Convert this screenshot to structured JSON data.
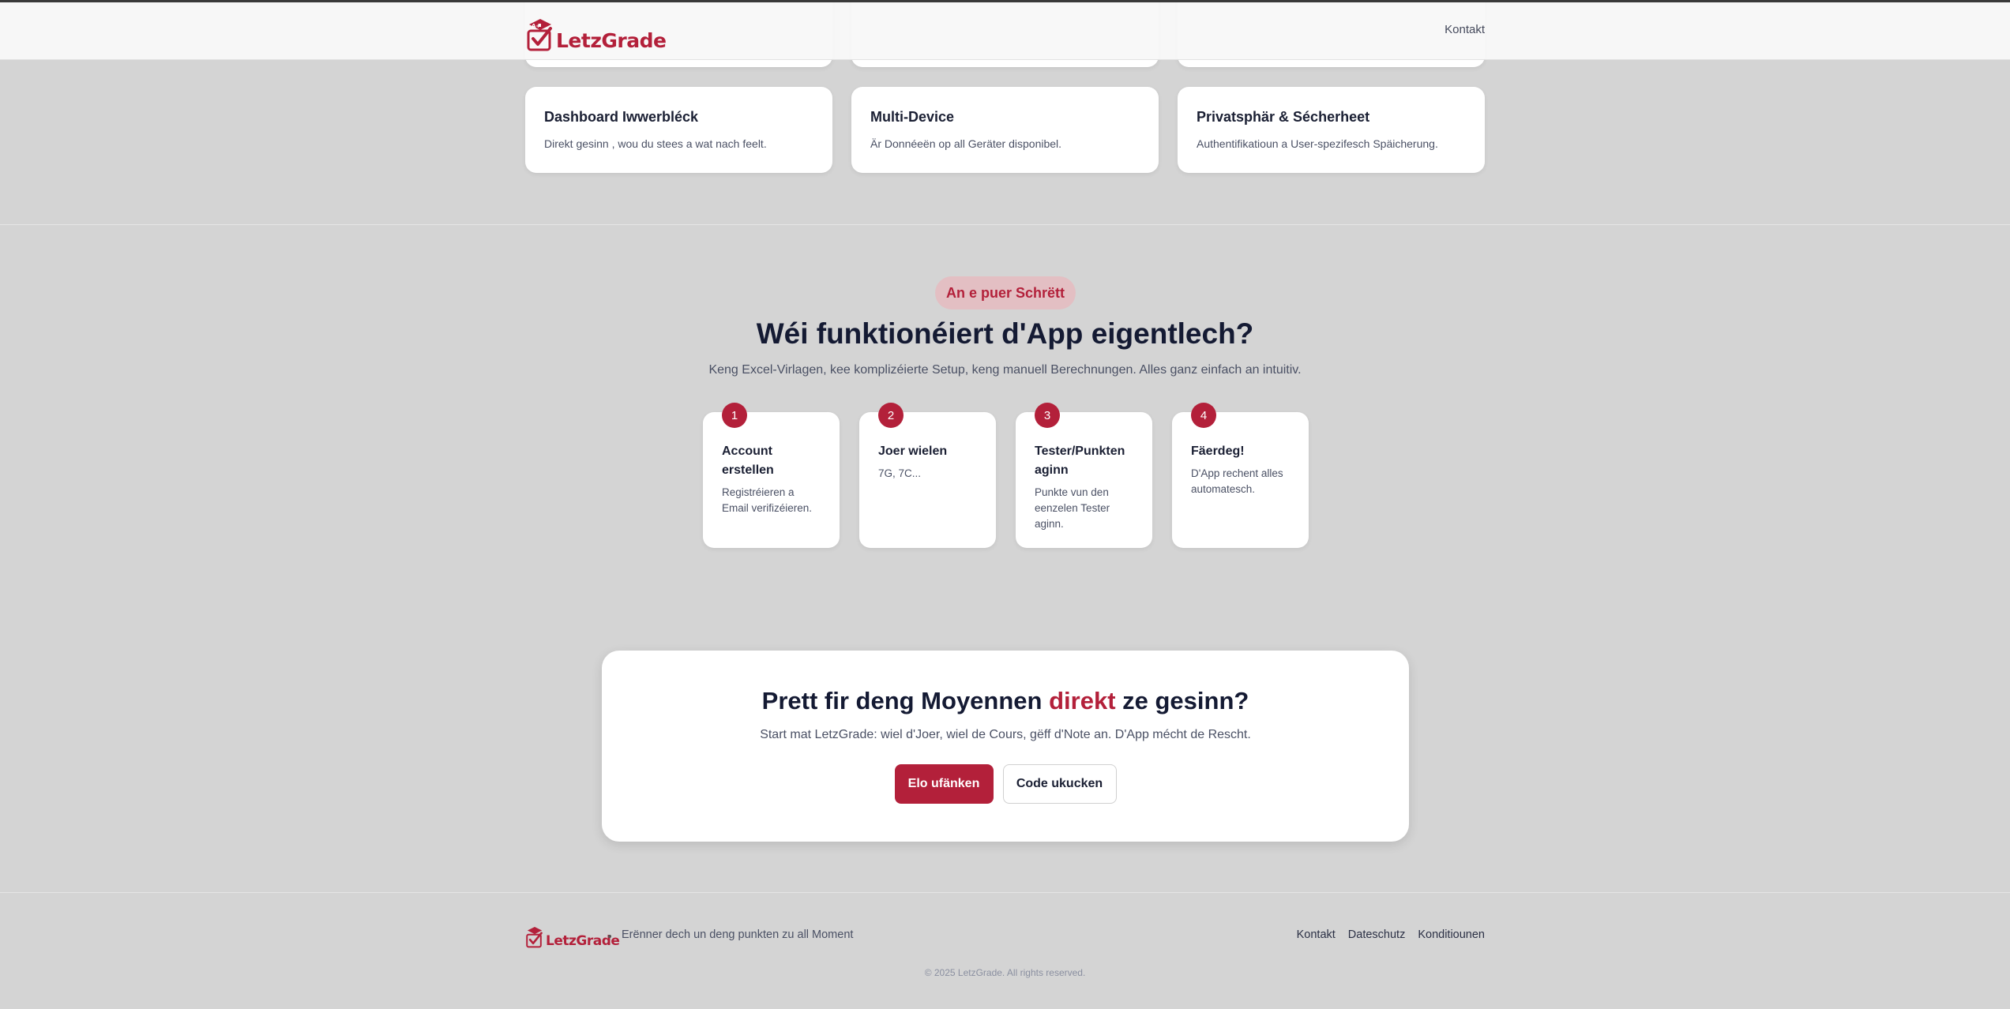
{
  "header": {
    "brand": "LetzGrade",
    "nav": {
      "contact": "Kontakt"
    }
  },
  "features": [
    {
      "title": "Dashboard Iwwerbléck",
      "description": "Direkt gesinn , wou du stees a wat nach feelt."
    },
    {
      "title": "Multi-Device",
      "description": "Är Donnéeën op all Geräter disponibel."
    },
    {
      "title": "Privatsphär & Sécherheet",
      "description": "Authentifikatioun a User-spezifesch Späicherung."
    }
  ],
  "how_it_works": {
    "badge": "An e puer Schrëtt",
    "title": "Wéi funktionéiert d'App eigentlech?",
    "subtitle": "Keng Excel-Virlagen, kee komplizéierte Setup, keng manuell Berechnungen. Alles ganz einfach an intuitiv.",
    "steps": [
      {
        "number": "1",
        "title": "Account erstellen",
        "description": "Registréieren a Email verifizéieren."
      },
      {
        "number": "2",
        "title": "Joer wielen",
        "description": "7G, 7C..."
      },
      {
        "number": "3",
        "title": "Tester/Punkten aginn",
        "description": "Punkte vun den eenzelen Tester aginn."
      },
      {
        "number": "4",
        "title": "Fäerdeg!",
        "description": "D'App rechent alles automatesch."
      }
    ]
  },
  "cta": {
    "title_before": "Prett fir deng Moyennen ",
    "title_accent": "direkt",
    "title_after": " ze gesinn?",
    "subtitle": "Start mat LetzGrade: wiel d'Joer, wiel de Cours, gëff d'Note an. D'App mécht de Rescht.",
    "primary_button": "Elo ufänken",
    "secondary_button": "Code ukucken"
  },
  "footer": {
    "brand": "LetzGrade",
    "tagline": "Erënner dech un deng punkten zu all Moment",
    "links": [
      "Kontakt",
      "Dateschutz",
      "Konditiounen"
    ],
    "copyright": "© 2025 LetzGrade. All rights reserved."
  },
  "colors": {
    "accent": "#b3203a",
    "background": "#d4d4d4",
    "card": "#ffffff",
    "badge_bg": "#e3bfc3",
    "heading": "#141a33"
  },
  "icons": {
    "logo": "graduation-cap-checkbox-icon"
  }
}
